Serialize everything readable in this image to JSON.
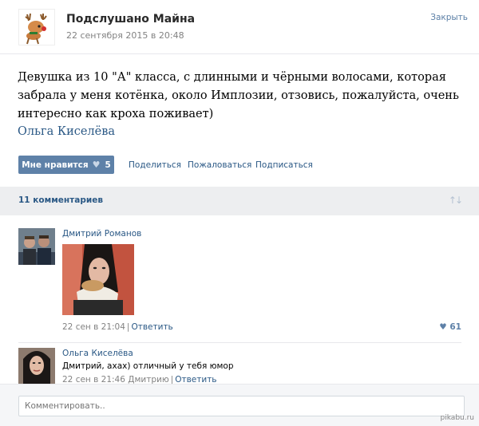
{
  "post": {
    "group_name": "Подслушано Майна",
    "date": "22 сентября 2015 в 20:48",
    "close_label": "Закрыть",
    "text": "Девушка из 10 \"А\" класса, с длинными и чёрными волосами, которая забрала у меня котёнка, около Имплозии, отзовись, пожалуйста, очень интересно как кроха поживает)",
    "signer": "Ольга Киселёва",
    "like_label": "Мне нравится",
    "like_count": "5",
    "share_label": "Поделиться",
    "report_label": "Пожаловаться",
    "subscribe_label": "Подписаться"
  },
  "comments_header": {
    "count_label": "11 комментариев"
  },
  "comments": [
    {
      "author": "Дмитрий Романов",
      "date": "22 сен в 21:04",
      "reply_label": "Ответить",
      "likes": "61"
    },
    {
      "author": "Ольга Киселёва",
      "text": "Дмитрий, ахах) отличный у тебя юмор",
      "date": "22 сен в 21:46",
      "reply_to": "Дмитрию",
      "reply_label": "Ответить"
    }
  ],
  "composer": {
    "placeholder": "Комментировать.."
  },
  "watermark": "pikabu.ru",
  "colors": {
    "link": "#2a5885",
    "button": "#5e81a8",
    "bar": "#edeef0"
  },
  "icons": [
    "deer-logo-icon",
    "heart-icon",
    "sort-arrows-icon"
  ]
}
